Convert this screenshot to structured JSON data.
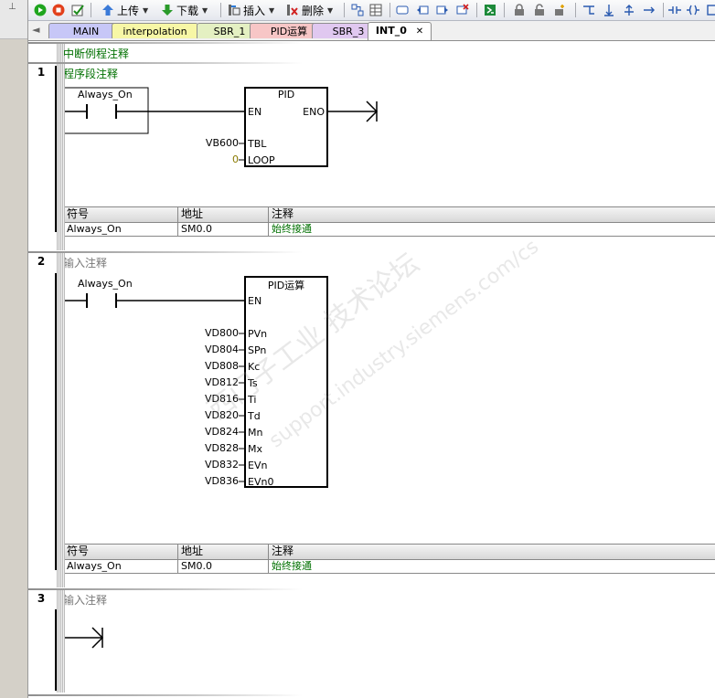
{
  "toolbar": {
    "upload_label": "上传",
    "download_label": "下载",
    "insert_label": "插入",
    "delete_label": "删除",
    "icons": [
      "run-icon",
      "stop-icon",
      "compile-icon",
      "upload-icon",
      "download-icon",
      "insert-icon",
      "delete-icon",
      "bookmark-icon",
      "overlay-icon",
      "lock-icon",
      "unlock-icon",
      "contact-icon",
      "coil-icon",
      "box-icon"
    ]
  },
  "tabs": [
    {
      "label": "MAIN",
      "color": "#c7c7f7"
    },
    {
      "label": "interpolation",
      "color": "#f7f7a6"
    },
    {
      "label": "SBR_1",
      "color": "#e4f0c2"
    },
    {
      "label": "PID运算",
      "color": "#f7c6c6"
    },
    {
      "label": "SBR_3",
      "color": "#e0c8f0"
    },
    {
      "label": "INT_0",
      "close": "✕",
      "active": true
    }
  ],
  "editor": {
    "pou_comment": "中断例程注释",
    "networks": [
      {
        "number": "1",
        "comment": "程序段注释",
        "contact_label": "Always_On",
        "block": {
          "name": "PID",
          "en": "EN",
          "eno": "ENO",
          "inputs": [
            {
              "operand": "VB600",
              "pin": "TBL"
            },
            {
              "operand": "0",
              "pin": "LOOP"
            }
          ]
        },
        "symbols": {
          "headers": [
            "符号",
            "地址",
            "注释"
          ],
          "rows": [
            [
              "Always_On",
              "SM0.0",
              "始终接通"
            ]
          ]
        }
      },
      {
        "number": "2",
        "comment": "输入注释",
        "contact_label": "Always_On",
        "block": {
          "name": "PID运算",
          "en": "EN",
          "inputs": [
            {
              "operand": "VD800",
              "pin": "PVn"
            },
            {
              "operand": "VD804",
              "pin": "SPn"
            },
            {
              "operand": "VD808",
              "pin": "Kc"
            },
            {
              "operand": "VD812",
              "pin": "Ts"
            },
            {
              "operand": "VD816",
              "pin": "Ti"
            },
            {
              "operand": "VD820",
              "pin": "Td"
            },
            {
              "operand": "VD824",
              "pin": "Mn"
            },
            {
              "operand": "VD828",
              "pin": "Mx"
            },
            {
              "operand": "VD832",
              "pin": "EVn"
            },
            {
              "operand": "VD836",
              "pin": "EVn0"
            }
          ]
        },
        "symbols": {
          "headers": [
            "符号",
            "地址",
            "注释"
          ],
          "rows": [
            [
              "Always_On",
              "SM0.0",
              "始终接通"
            ]
          ]
        }
      },
      {
        "number": "3",
        "comment": "输入注释"
      }
    ]
  },
  "watermark": {
    "line1": "西门子工业  技术论坛",
    "line2": "support.industry.siemens.com/cs"
  }
}
